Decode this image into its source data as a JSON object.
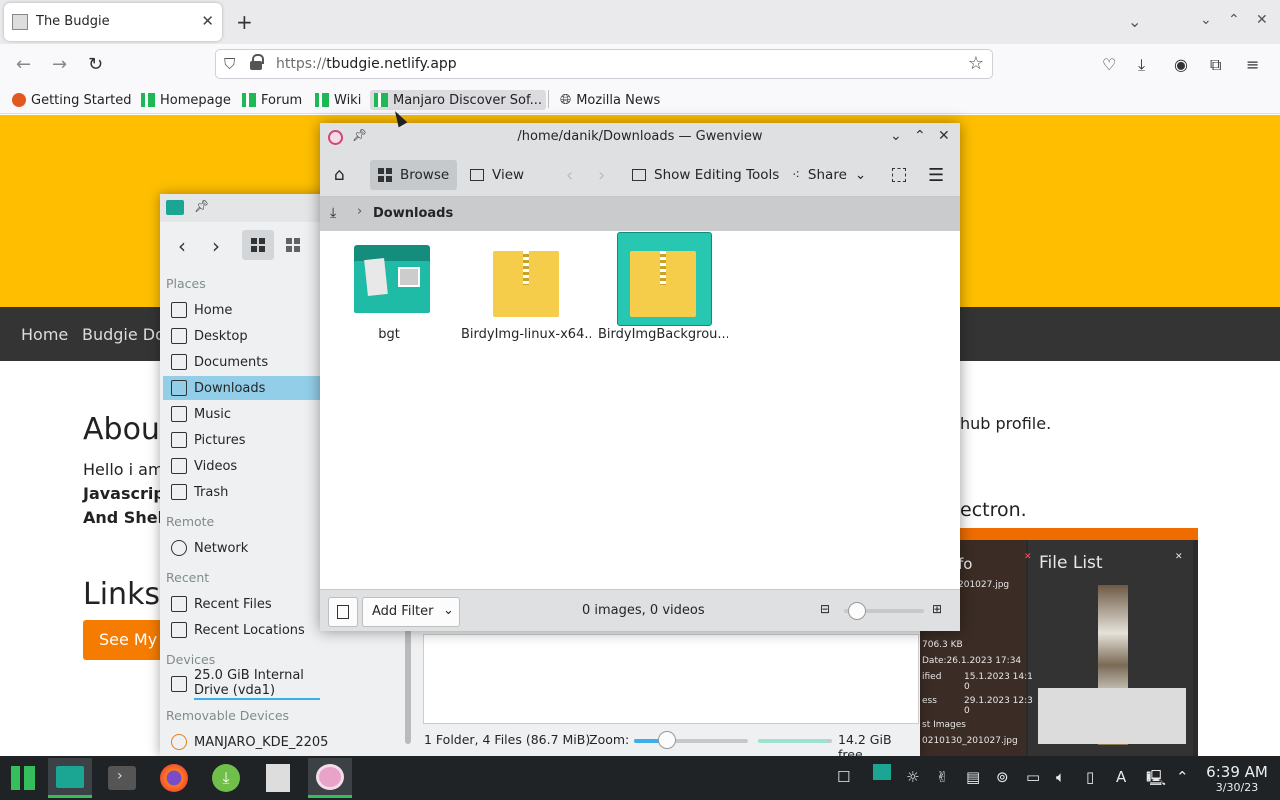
{
  "browser": {
    "tab_title": "The Budgie",
    "url_protocol": "https://",
    "url_host": "tbudgie.netlify.app",
    "bookmarks": [
      "Getting Started",
      "Homepage",
      "Forum",
      "Wiki",
      "Manjaro Discover Sof...",
      "Mozilla News"
    ]
  },
  "page": {
    "nav": [
      "Home",
      "Budgie Do"
    ],
    "about_heading": "Abou",
    "intro_line": "Hello i am",
    "skills_1": "Javascript",
    "skills_2": "And Shell",
    "github_frag": "hub profile.",
    "electron_frag": "ectron.",
    "links_heading": "Links",
    "button": "See My S"
  },
  "birdy": {
    "file_list": "File List",
    "info_lines": [
      "fo",
      "201027.jpg",
      "Date:26.1.2023 17:34",
      "ified",
      "15.1.2023 14:1",
      "0",
      "ess",
      "29.1.2023 12:3",
      "0",
      "st Images",
      "0210130_201027.jpg",
      "706.3 KB"
    ]
  },
  "dolphin": {
    "places_title": "Places",
    "places": [
      "Home",
      "Desktop",
      "Documents",
      "Downloads",
      "Music",
      "Pictures",
      "Videos",
      "Trash"
    ],
    "remote_title": "Remote",
    "remote": [
      "Network"
    ],
    "recent_title": "Recent",
    "recent": [
      "Recent Files",
      "Recent Locations"
    ],
    "devices_title": "Devices",
    "devices": [
      "25.0 GiB Internal Drive (vda1)"
    ],
    "removable_title": "Removable Devices",
    "removable": [
      "MANJARO_KDE_2205"
    ],
    "status": "1 Folder, 4 Files (86.7 MiB)",
    "zoom_label": "Zoom:",
    "free_space": "14.2 GiB free"
  },
  "gwenview": {
    "title": "/home/danik/Downloads — Gwenview",
    "browse": "Browse",
    "view": "View",
    "editing": "Show Editing Tools",
    "share": "Share",
    "crumb": "Downloads",
    "items": [
      "bgt",
      "BirdyImg-linux-x64...",
      "BirdyImgBackgrou..."
    ],
    "add_filter": "Add Filter",
    "status": "0 images, 0 videos",
    "zoom_level": 0.1
  },
  "clock": {
    "time": "6:39 AM",
    "date": "3/30/23"
  },
  "colors": {
    "accent": "#ffbf00",
    "highlight": "#93cee9",
    "selection": "#27c7b1",
    "manjaro": "#35bf5c"
  }
}
